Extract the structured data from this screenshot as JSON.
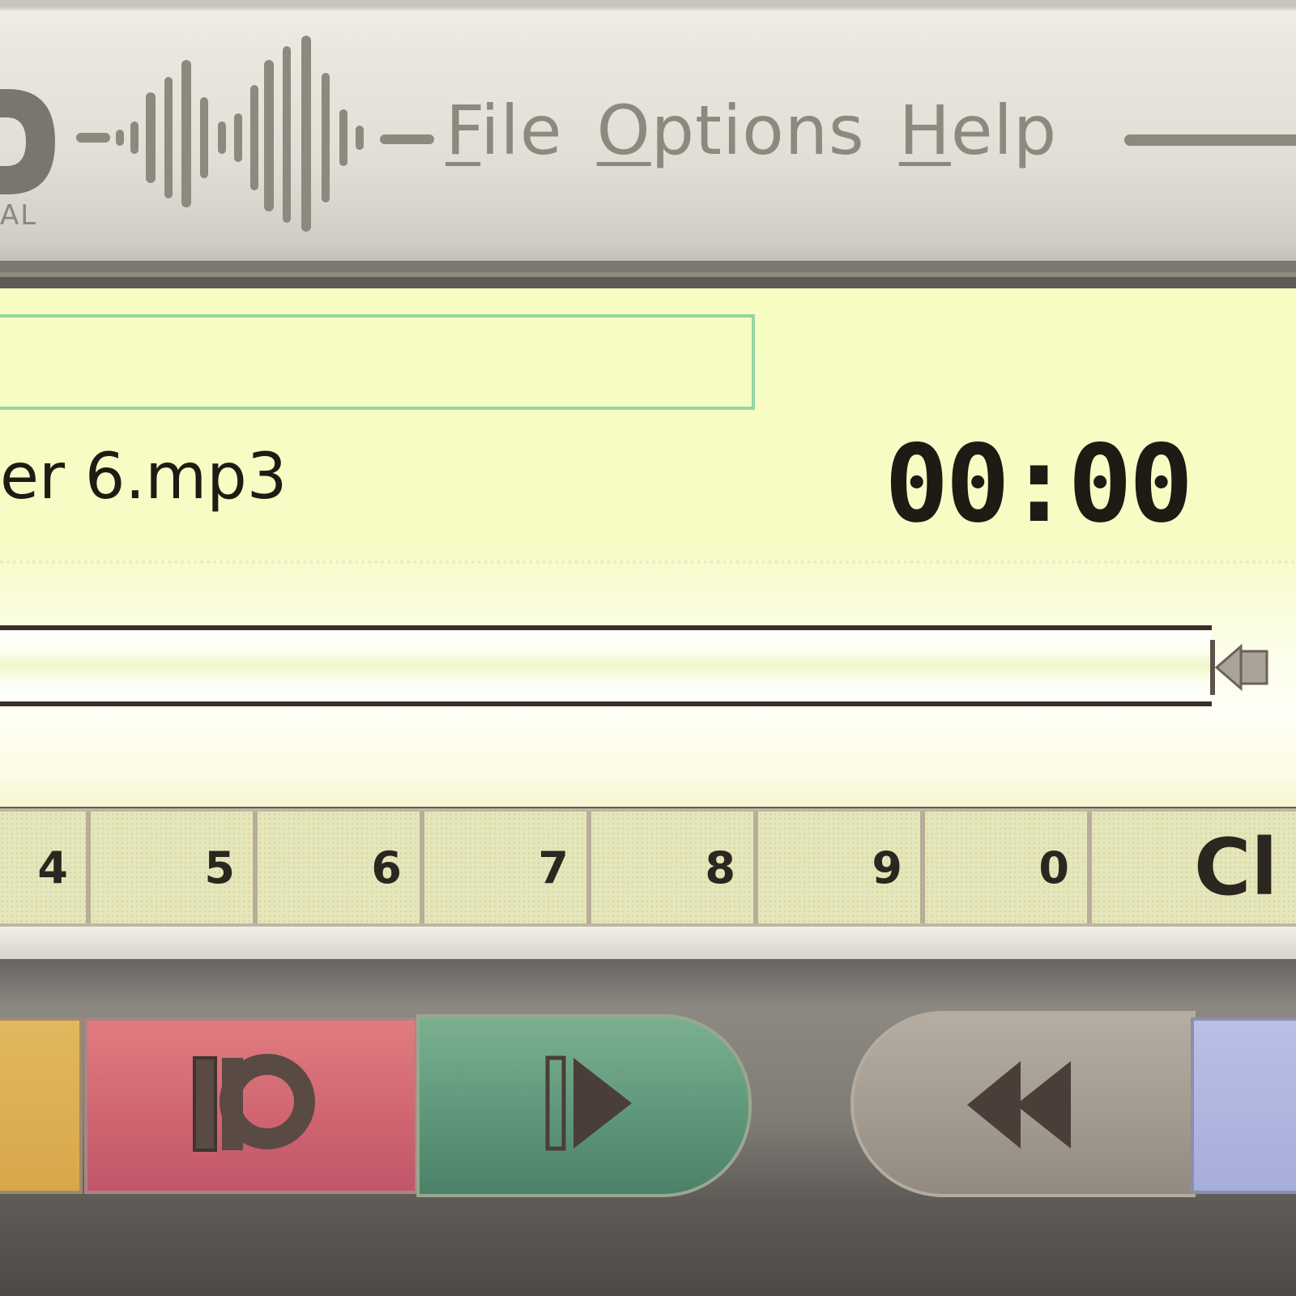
{
  "app": {
    "logo_sub_text": "AL"
  },
  "menu": {
    "items": [
      {
        "label": "File",
        "accel": "F",
        "rest": "ile"
      },
      {
        "label": "Options",
        "accel": "O",
        "rest": "ptions"
      },
      {
        "label": "Help",
        "accel": "H",
        "rest": "elp"
      }
    ]
  },
  "display": {
    "title_field_value": "",
    "filename": "er 6.mp3",
    "timer": "00:00",
    "progress_fraction": 0
  },
  "keypad": {
    "keys": [
      "4",
      "5",
      "6",
      "7",
      "8",
      "9",
      "0"
    ],
    "clear_label": "Cl"
  },
  "transport": {
    "buttons": [
      "record-button",
      "play-button",
      "rewind-button"
    ]
  },
  "colors": {
    "display_bg": "#f6fcc2",
    "record": "#cf6470",
    "play": "#5d957a",
    "rewind": "#a29a8f",
    "menu_text": "#8d897f",
    "timer_text": "#1e1a14"
  },
  "icons": [
    "logo-icon",
    "waveform-icon",
    "record-icon",
    "play-icon",
    "rewind-icon",
    "volume-icon"
  ]
}
